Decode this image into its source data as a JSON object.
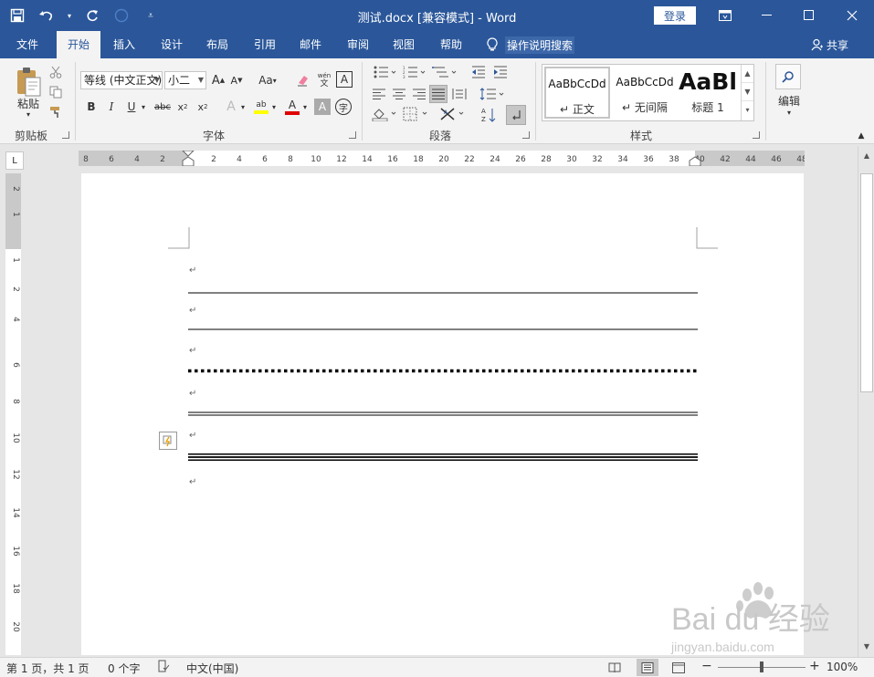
{
  "titlebar": {
    "doc_title": "测试.docx [兼容模式]  -  Word",
    "login": "登录"
  },
  "tabs": [
    "文件",
    "开始",
    "插入",
    "设计",
    "布局",
    "引用",
    "邮件",
    "审阅",
    "视图",
    "帮助"
  ],
  "tellme": {
    "label": "操作说明搜索"
  },
  "share": {
    "label": "共享"
  },
  "ribbon": {
    "clipboard": {
      "paste": "粘贴",
      "label": "剪贴板"
    },
    "font": {
      "font_name": "等线 (中文正文)",
      "font_size": "小二",
      "label": "字体"
    },
    "paragraph": {
      "label": "段落"
    },
    "styles": {
      "label": "样式",
      "items": [
        {
          "sample": "AaBbCcDd",
          "name": "正文"
        },
        {
          "sample": "AaBbCcDd",
          "name": "无间隔"
        },
        {
          "sample": "AaBl",
          "name": "标题 1"
        }
      ]
    },
    "editing": {
      "label": "编辑"
    }
  },
  "ruler": {
    "h_ticks_left": [
      "8",
      "6",
      "4",
      "2"
    ],
    "h_ticks_right": [
      "2",
      "4",
      "6",
      "8",
      "10",
      "12",
      "14",
      "16",
      "18",
      "20",
      "22",
      "24",
      "26",
      "28",
      "30",
      "32",
      "34",
      "36",
      "38",
      "40",
      "42",
      "44",
      "46",
      "48"
    ],
    "v_ticks": [
      "2",
      "1",
      "1",
      "2",
      "4",
      "6",
      "8",
      "10",
      "12",
      "14",
      "16",
      "18",
      "20"
    ]
  },
  "document": {
    "para_mark": "↵"
  },
  "statusbar": {
    "page": "第 1 页，共 1 页",
    "words": "0 个字",
    "language": "中文(中国)",
    "zoom": "100%"
  },
  "watermark": {
    "brand": "Bai du 经验",
    "url": "jingyan.baidu.com"
  },
  "colors": {
    "title_bar": "#2b579a",
    "ribbon_bg": "#f3f3f3",
    "highlight_yellow": "#ffff00",
    "font_red": "#e00000"
  }
}
